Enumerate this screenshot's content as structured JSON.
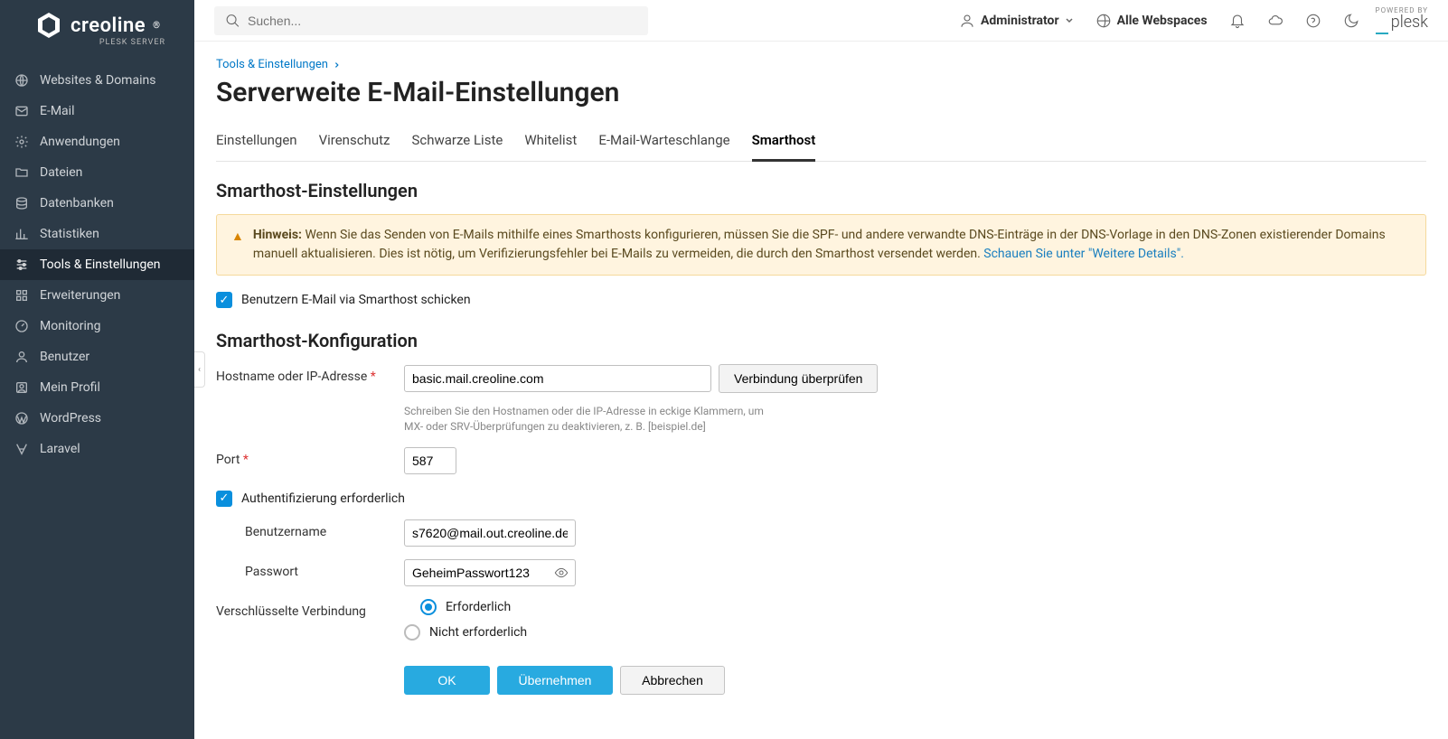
{
  "brand": {
    "name": "creoline",
    "sub": "PLESK SERVER"
  },
  "sidebar": {
    "items": [
      {
        "label": "Websites & Domains"
      },
      {
        "label": "E-Mail"
      },
      {
        "label": "Anwendungen"
      },
      {
        "label": "Dateien"
      },
      {
        "label": "Datenbanken"
      },
      {
        "label": "Statistiken"
      },
      {
        "label": "Tools & Einstellungen"
      },
      {
        "label": "Erweiterungen"
      },
      {
        "label": "Monitoring"
      },
      {
        "label": "Benutzer"
      },
      {
        "label": "Mein Profil"
      },
      {
        "label": "WordPress"
      },
      {
        "label": "Laravel"
      }
    ]
  },
  "topbar": {
    "search_placeholder": "Suchen...",
    "user": "Administrator",
    "webspaces": "Alle Webspaces",
    "powered_label": "POWERED BY",
    "powered_brand": "plesk"
  },
  "breadcrumb": {
    "parent": "Tools & Einstellungen"
  },
  "page_title": "Serverweite E-Mail-Einstellungen",
  "tabs": [
    {
      "label": "Einstellungen"
    },
    {
      "label": "Virenschutz"
    },
    {
      "label": "Schwarze Liste"
    },
    {
      "label": "Whitelist"
    },
    {
      "label": "E-Mail-Warteschlange"
    },
    {
      "label": "Smarthost"
    }
  ],
  "section1_title": "Smarthost-Einstellungen",
  "alert": {
    "prefix": "Hinweis:",
    "text": " Wenn Sie das Senden von E-Mails mithilfe eines Smarthosts konfigurieren, müssen Sie die SPF- und andere verwandte DNS-Einträge in der DNS-Vorlage in den DNS-Zonen existierender Domains manuell aktualisieren. Dies ist nötig, um Verifizierungsfehler bei E-Mails zu vermeiden, die durch den Smarthost versendet werden. ",
    "link": "Schauen Sie unter \"Weitere Details\"."
  },
  "checkbox_send": "Benutzern E-Mail via Smarthost schicken",
  "section2_title": "Smarthost-Konfiguration",
  "form": {
    "hostname_label": "Hostname oder IP-Adresse",
    "hostname_value": "basic.mail.creoline.com",
    "check_btn": "Verbindung überprüfen",
    "hostname_hint": "Schreiben Sie den Hostnamen oder die IP-Adresse in eckige Klammern, um MX- oder SRV-Überprüfungen zu deaktivieren, z. B. [beispiel.de]",
    "port_label": "Port",
    "port_value": "587",
    "auth_label": "Authentifizierung erforderlich",
    "user_label": "Benutzername",
    "user_value": "s7620@mail.out.creoline.de",
    "pass_label": "Passwort",
    "pass_value": "GeheimPasswort123",
    "enc_label": "Verschlüsselte Verbindung",
    "enc_required": "Erforderlich",
    "enc_not_required": "Nicht erforderlich"
  },
  "actions": {
    "ok": "OK",
    "apply": "Übernehmen",
    "cancel": "Abbrechen"
  }
}
